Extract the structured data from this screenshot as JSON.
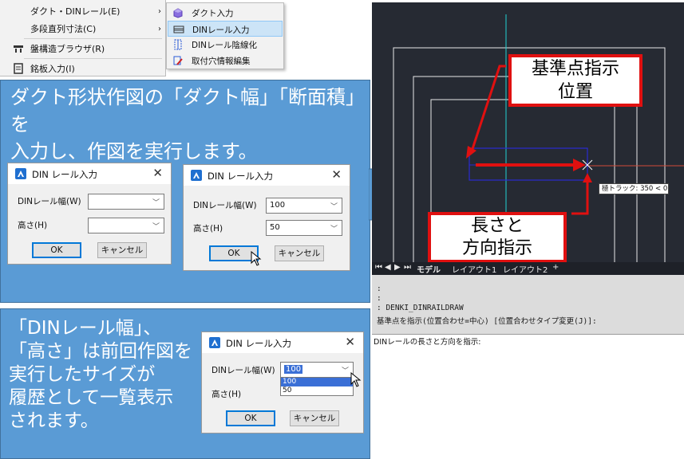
{
  "menu": {
    "items": [
      {
        "label": "ダクト・DINレール(E)",
        "arrow": "›"
      },
      {
        "label": "多段直列寸法(C)",
        "arrow": "›"
      },
      {
        "label": "盤構造ブラウザ(R)"
      },
      {
        "label": "銘板入力(I)"
      }
    ],
    "submenu": [
      {
        "label": "ダクト入力"
      },
      {
        "label": "DINレール入力"
      },
      {
        "label": "DINレール陰線化"
      },
      {
        "label": "取付穴情報編集"
      }
    ]
  },
  "panel_top": {
    "text": "ダクト形状作図の「ダクト幅」「断面積」を\n入力し、作図を実行します。"
  },
  "panel_bottom": {
    "text": "「DINレール幅」、\n「高さ」は前回作図を\n実行したサイズが\n履歴として一覧表示\nされます。"
  },
  "dialog_empty": {
    "title": "DIN レール入力",
    "close": "✕",
    "width_label": "DINレール幅(W)",
    "height_label": "高さ(H)",
    "width_value": "",
    "height_value": "",
    "ok": "OK",
    "cancel": "キャンセル"
  },
  "dialog_filled": {
    "title": "DIN レール入力",
    "close": "✕",
    "width_label": "DINレール幅(W)",
    "height_label": "高さ(H)",
    "width_value": "100",
    "height_value": "50",
    "ok": "OK",
    "cancel": "キャンセル"
  },
  "dialog_history": {
    "title": "DIN レール入力",
    "close": "✕",
    "width_label": "DINレール幅(W)",
    "height_label": "高さ(H)",
    "width_value": "100",
    "options": [
      "100",
      "50"
    ],
    "ok": "OK",
    "cancel": "キャンセル"
  },
  "cad": {
    "callout_base": "基準点指示\n位置",
    "callout_length": "長さと\n方向指示",
    "tooltip": "極トラック: 350 < 0",
    "tabs": [
      "モデル",
      "レイアウト1",
      "レイアウト2",
      "+"
    ],
    "command_lines": [
      ":",
      ":",
      ": DENKI_DINRAILDRAW",
      "基準点を指示(位置合わせ=中心) [位置合わせタイプ変更(J)]:"
    ],
    "command_prompt": "DINレールの長さと方向を指示:"
  },
  "colors": {
    "panel": "#5a9bd5",
    "callout_border": "#e01010",
    "cad_bg": "#262a33"
  }
}
